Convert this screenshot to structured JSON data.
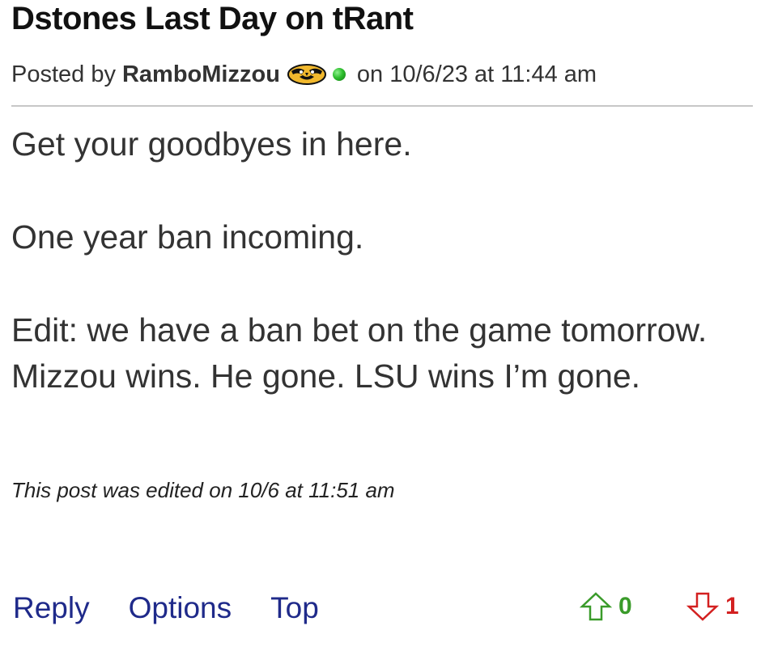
{
  "post": {
    "title": "Dstones Last Day on tRant",
    "posted_by_label": "Posted by",
    "author": "RamboMizzou",
    "team_logo_icon": "mizzou-tiger-logo-icon",
    "online_status_icon": "online-dot-icon",
    "date_text": "on 10/6/23 at 11:44 am",
    "body": [
      "Get your goodbyes in here.",
      "One year ban incoming.",
      "Edit: we have a ban bet on the game tomorrow. Mizzou wins. He gone. LSU wins I’m gone."
    ],
    "edited_note": "This post was edited on 10/6 at 11:51 am"
  },
  "actions": {
    "reply_label": "Reply",
    "options_label": "Options",
    "top_label": "Top"
  },
  "votes": {
    "up_count": "0",
    "down_count": "1",
    "up_icon": "arrow-up-outline-icon",
    "down_icon": "arrow-down-outline-icon"
  },
  "colors": {
    "link": "#1f2a8a",
    "upvote": "#3a9b2a",
    "downvote": "#d32020",
    "divider": "#c7c7c7",
    "online": "#2fbf2f"
  }
}
